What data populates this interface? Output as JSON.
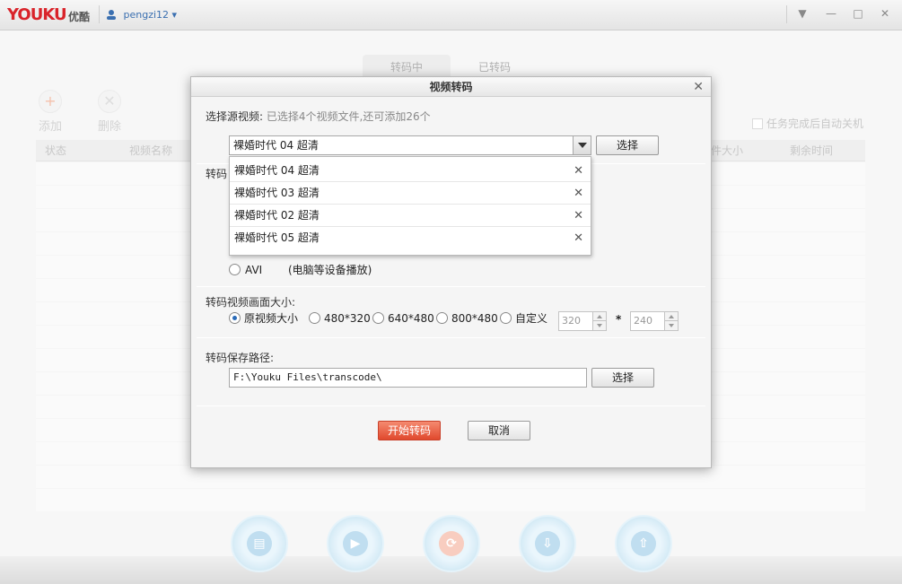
{
  "app": {
    "logo_latin": "YOUKU",
    "logo_cn": "优酷",
    "username": "pengzi12"
  },
  "main": {
    "tabs": [
      {
        "label": "转码中"
      },
      {
        "label": "已转码"
      }
    ],
    "toolbar": {
      "add_label": "添加",
      "delete_label": "删除"
    },
    "auto_shutdown_label": "任务完成后自动关机",
    "columns": [
      "状态",
      "视频名称",
      "件大小",
      "剩余时间"
    ]
  },
  "dialog": {
    "title": "视频转码",
    "source_label": "选择源视频:",
    "source_hint": "已选择4个视频文件,还可添加26个",
    "selected_video": "裸婚时代 04 超清",
    "select_button": "选择",
    "dropdown_items": [
      {
        "label": "裸婚时代 04 超清"
      },
      {
        "label": "裸婚时代 03 超清"
      },
      {
        "label": "裸婚时代 02 超清"
      },
      {
        "label": "裸婚时代 05 超清"
      }
    ],
    "format_label_partial": "转码",
    "avi_label": "AVI",
    "avi_desc": "(电脑等设备播放)",
    "size_label": "转码视频画面大小:",
    "size_options": [
      {
        "label": "原视频大小",
        "selected": true
      },
      {
        "label": "480*320",
        "selected": false
      },
      {
        "label": "640*480",
        "selected": false
      },
      {
        "label": "800*480",
        "selected": false
      },
      {
        "label": "自定义",
        "selected": false
      }
    ],
    "custom_width": "320",
    "custom_times": "*",
    "custom_height": "240",
    "path_label": "转码保存路径:",
    "path_value": "F:\\Youku Files\\transcode\\",
    "path_button": "选择",
    "start_button": "开始转码",
    "cancel_button": "取消"
  }
}
